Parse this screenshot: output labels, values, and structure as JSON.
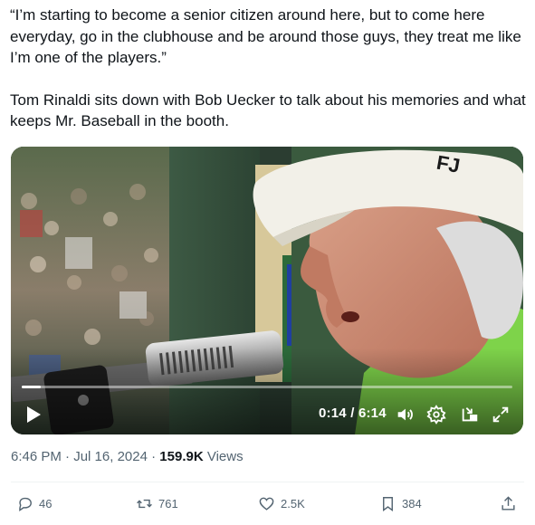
{
  "tweet": {
    "quote": "“I’m starting to become a senior citizen around here, but to come here everyday, go in the clubhouse and be around those guys, they treat me like I’m one of the players.”",
    "body": "Tom Rinaldi sits down with Bob Uecker to talk about his memories and what keeps Mr. Baseball in the booth."
  },
  "video": {
    "cap_logo": "FJ",
    "time_current": "0:14",
    "time_separator": " / ",
    "time_total": "6:14",
    "progress_fraction": 0.038
  },
  "meta": {
    "time": "6:46 PM",
    "sep1": " · ",
    "date": "Jul 16, 2024",
    "sep2": " · ",
    "views_count": "159.9K",
    "views_label": " Views"
  },
  "actions": {
    "replies": "46",
    "reposts": "761",
    "likes": "2.5K",
    "bookmarks": "384"
  },
  "icons": [
    "play-icon",
    "volume-icon",
    "settings-icon",
    "pip-icon",
    "fullscreen-icon",
    "reply-icon",
    "repost-icon",
    "like-icon",
    "bookmark-icon",
    "share-icon"
  ]
}
